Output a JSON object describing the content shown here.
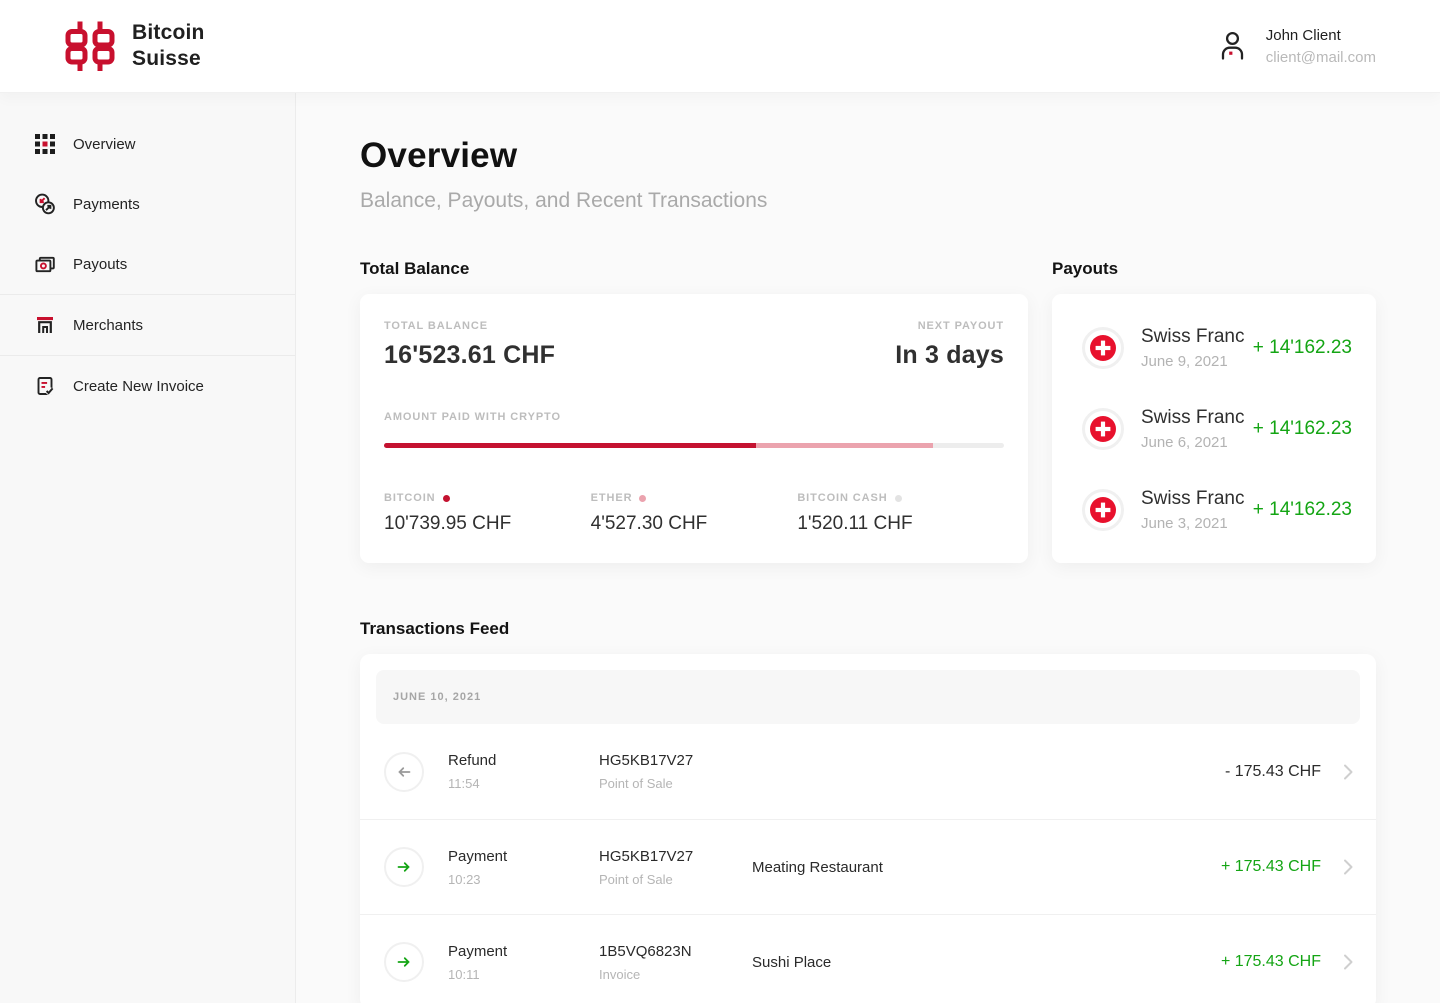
{
  "colors": {
    "brand_red": "#c8102e",
    "flag_red": "#e8112d",
    "green": "#14a514",
    "pink": "#eba3ae",
    "track": "#ededed",
    "dark": "#2c2c2c"
  },
  "header": {
    "brand_line1": "Bitcoin",
    "brand_line2": "Suisse",
    "user_name": "John Client",
    "user_email": "client@mail.com"
  },
  "sidebar": {
    "items": [
      {
        "label": "Overview"
      },
      {
        "label": "Payments"
      },
      {
        "label": "Payouts"
      },
      {
        "label": "Merchants"
      },
      {
        "label": "Create New Invoice"
      }
    ]
  },
  "page": {
    "title": "Overview",
    "subtitle": "Balance, Payouts, and Recent Transactions"
  },
  "balance": {
    "section_title": "Total Balance",
    "label": "TOTAL BALANCE",
    "value": "16'523.61 CHF",
    "next_payout_label": "NEXT PAYOUT",
    "next_payout_value": "In 3 days",
    "crypto_label": "AMOUNT PAID WITH CRYPTO",
    "segments": [
      {
        "name": "BITCOIN",
        "value": "10'739.95 CHF",
        "percent": 60,
        "color": "#c41230"
      },
      {
        "name": "ETHER",
        "value": "4'527.30 CHF",
        "percent": 28.5,
        "color": "#eba3ae"
      },
      {
        "name": "BITCOIN CASH",
        "value": "1'520.11 CHF",
        "percent": 11.5,
        "color": "#e3e3e3"
      }
    ]
  },
  "payouts": {
    "section_title": "Payouts",
    "items": [
      {
        "currency": "Swiss Franc",
        "date": "June 9, 2021",
        "amount": "+ 14'162.23"
      },
      {
        "currency": "Swiss Franc",
        "date": "June 6, 2021",
        "amount": "+ 14'162.23"
      },
      {
        "currency": "Swiss Franc",
        "date": "June 3, 2021",
        "amount": "+ 14'162.23"
      }
    ]
  },
  "transactions": {
    "section_title": "Transactions Feed",
    "date_header": "JUNE 10, 2021",
    "rows": [
      {
        "type": "Refund",
        "time": "11:54",
        "code": "HG5KB17V27",
        "channel": "Point of Sale",
        "merchant": "",
        "amount": "- 175.43 CHF",
        "positive": false
      },
      {
        "type": "Payment",
        "time": "10:23",
        "code": "HG5KB17V27",
        "channel": "Point of Sale",
        "merchant": "Meating Restaurant",
        "amount": "+ 175.43 CHF",
        "positive": true
      },
      {
        "type": "Payment",
        "time": "10:11",
        "code": "1B5VQ6823N",
        "channel": "Invoice",
        "merchant": "Sushi Place",
        "amount": "+ 175.43 CHF",
        "positive": true
      }
    ]
  }
}
